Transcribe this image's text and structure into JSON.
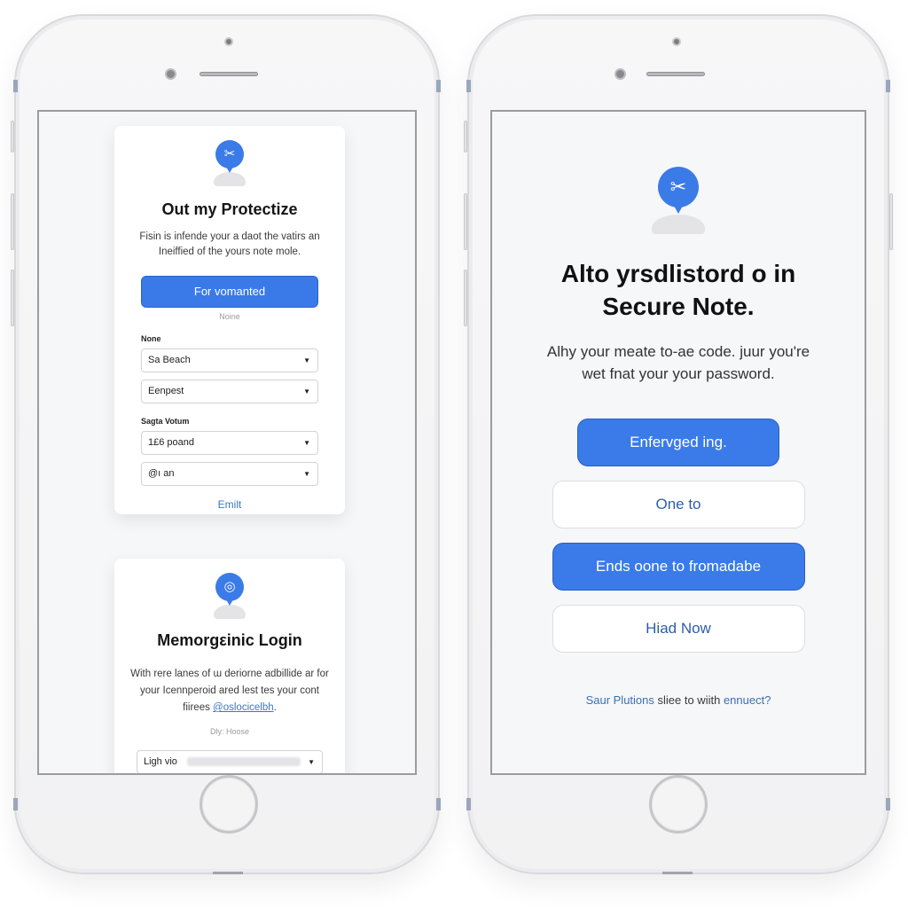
{
  "left_phone": {
    "card_protect": {
      "icon": "shield-lock-icon",
      "title": "Out my Protectize",
      "description": "Fisin is infende your a daot the vatirs an Ineiffied of the yours note mole.",
      "primary_button": "For vomanted",
      "hint": "Noine",
      "section1_label": "None",
      "select1_value": "Sa Beach",
      "select2_value": "Eenpest",
      "section2_label": "Sagta Votum",
      "select3_value": "1£6 poand",
      "select4_value": "@ı an",
      "link_button": "Emilt"
    },
    "card_login": {
      "icon": "fingerprint-icon",
      "title": "Memorgεinic Login",
      "description_before_link": "With rere lanes of ɯ deriorne adbillide ar for your Icennperoid ared lest tes your cont fiirees ",
      "description_link": "@oslocicelbh",
      "description_after_link": ".",
      "hint": "Dly: Hoose",
      "select_label": "Ligh vio",
      "select_value_blurred": true
    }
  },
  "right_phone": {
    "icon": "key-lock-icon",
    "title_line1": "Alto yrsdlistord o in",
    "title_line2": "Secure Note.",
    "description_line1": "Alhy your meate to-ae code. juur you're",
    "description_line2": "wet fnat your your password.",
    "buttons": [
      {
        "label": "Enfervged ing.",
        "style": "filled"
      },
      {
        "label": "One to",
        "style": "outline"
      },
      {
        "label": "Ends oone to fromadabe",
        "style": "filled"
      },
      {
        "label": "Hiad Now",
        "style": "outline"
      }
    ],
    "footer_link1": "Saur Plutions",
    "footer_text": " sliee to wiith ",
    "footer_link2": "ennuect?"
  },
  "colors": {
    "accent": "#3a7be9",
    "link": "#3a78c8",
    "screen_bg": "#f6f7f9"
  }
}
